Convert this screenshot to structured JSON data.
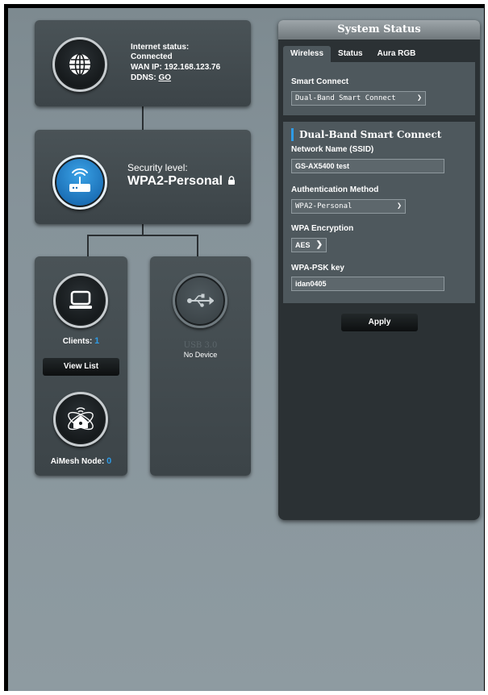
{
  "internet": {
    "status_label": "Internet status:",
    "status_value": "Connected",
    "wan_label": "WAN IP:",
    "wan_value": "192.168.123.76",
    "ddns_label": "DDNS:",
    "ddns_link": "GO"
  },
  "router": {
    "security_label": "Security level:",
    "security_value": "WPA2-Personal"
  },
  "clients": {
    "label": "Clients:",
    "count": "1",
    "view_list": "View List"
  },
  "aimesh": {
    "label": "AiMesh Node:",
    "count": "0"
  },
  "usb": {
    "label": "USB 3.0",
    "status": "No Device"
  },
  "system_status": {
    "title": "System Status",
    "tabs": [
      "Wireless",
      "Status",
      "Aura RGB"
    ],
    "active_tab": "Wireless",
    "smart_connect_label": "Smart Connect",
    "smart_connect_value": "Dual-Band Smart Connect",
    "band_heading": "Dual-Band Smart Connect",
    "ssid_label": "Network Name (SSID)",
    "ssid_value": "GS-AX5400 test",
    "auth_label": "Authentication Method",
    "auth_value": "WPA2-Personal",
    "enc_label": "WPA Encryption",
    "enc_value": "AES",
    "psk_label": "WPA-PSK key",
    "psk_value": "idan0405",
    "apply": "Apply"
  },
  "colors": {
    "accent": "#2e9be6",
    "panel": "#2b3134",
    "section": "#4e585d"
  }
}
